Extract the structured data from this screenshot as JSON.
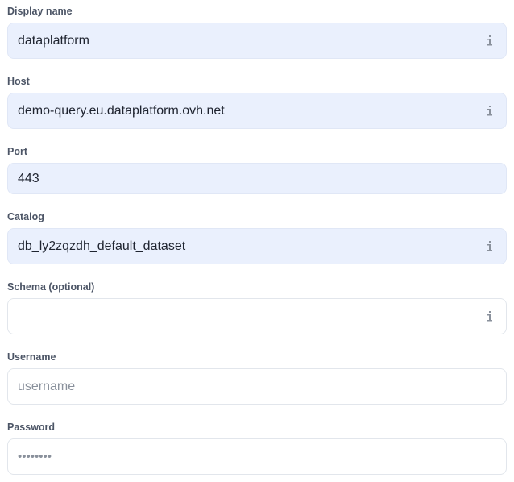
{
  "fields": {
    "display_name": {
      "label": "Display name",
      "value": "dataplatform",
      "icon": "info-icon"
    },
    "host": {
      "label": "Host",
      "value": "demo-query.eu.dataplatform.ovh.net",
      "icon": "info-icon"
    },
    "port": {
      "label": "Port",
      "value": "443"
    },
    "catalog": {
      "label": "Catalog",
      "value": "db_ly2zqzdh_default_dataset",
      "icon": "info-icon"
    },
    "schema": {
      "label": "Schema (optional)",
      "value": "",
      "icon": "info-icon"
    },
    "username": {
      "label": "Username",
      "placeholder": "username",
      "value": ""
    },
    "password": {
      "label": "Password",
      "value": "••••••••"
    }
  },
  "colors": {
    "filled_field_bg": "#eaf0fd",
    "label": "#4c5566",
    "text": "#1f2430",
    "placeholder": "#8a919c",
    "border": "#e2e6ec"
  }
}
